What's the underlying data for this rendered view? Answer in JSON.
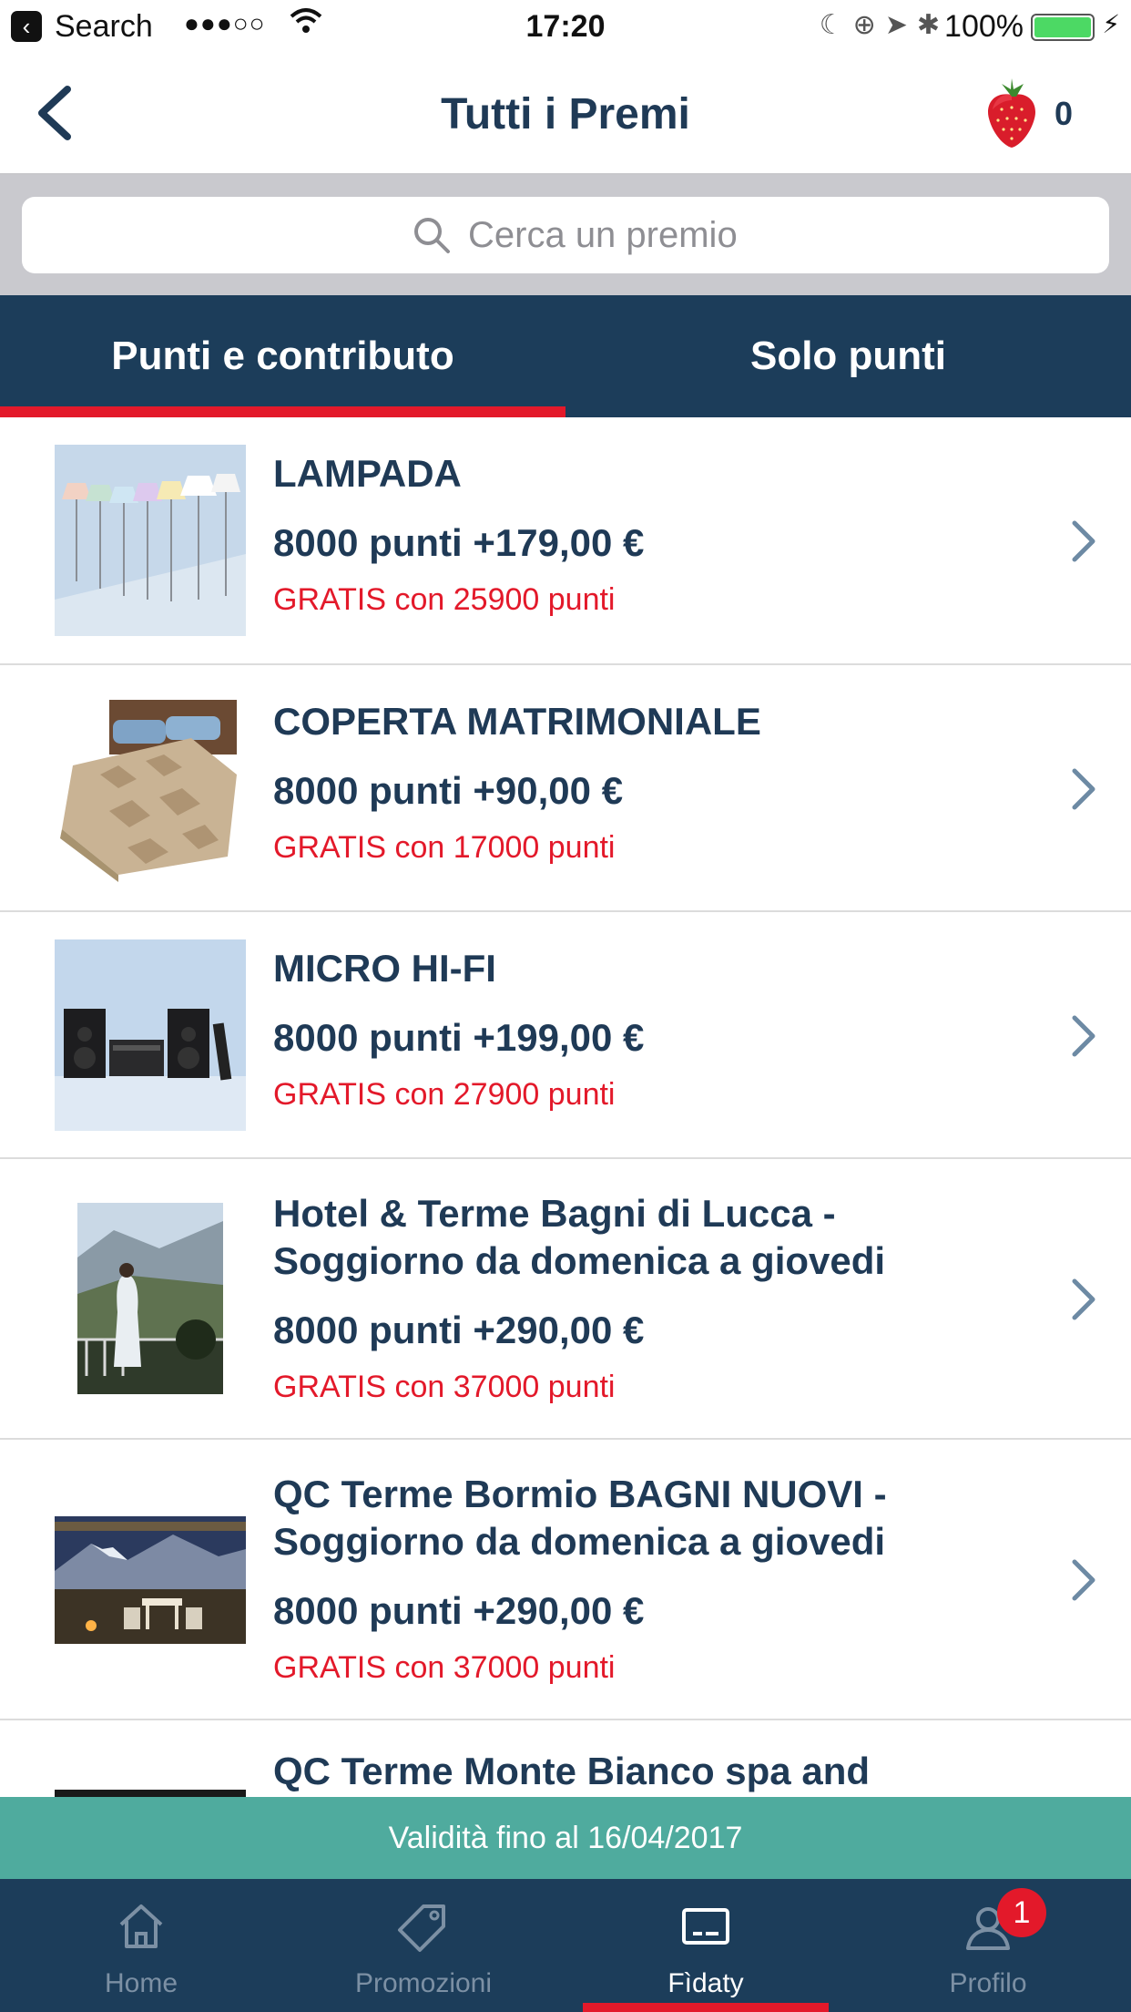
{
  "status_bar": {
    "carrier": "Search",
    "signal": "●●●○○",
    "time": "17:20",
    "battery": "100%"
  },
  "nav": {
    "title": "Tutti i Premi",
    "points": "0",
    "back_icon": "chevron-left-icon",
    "points_icon": "strawberry-icon"
  },
  "search": {
    "placeholder": "Cerca un premio",
    "value": ""
  },
  "tabs": [
    {
      "label": "Punti e contributo",
      "active": true
    },
    {
      "label": "Solo punti",
      "active": false
    }
  ],
  "items": [
    {
      "name": "LAMPADA",
      "price": "8000 punti +179,00 €",
      "free": "GRATIS con 25900 punti"
    },
    {
      "name": "COPERTA MATRIMONIALE",
      "price": "8000 punti +90,00 €",
      "free": "GRATIS con 17000 punti"
    },
    {
      "name": "MICRO HI-FI",
      "price": "8000 punti +199,00 €",
      "free": "GRATIS con 27900 punti"
    },
    {
      "name": "Hotel & Terme Bagni di Lucca - Soggiorno da domenica a giovedi",
      "price": "8000 punti +290,00 €",
      "free": "GRATIS con 37000 punti"
    },
    {
      "name": "QC Terme Bormio BAGNI NUOVI - Soggiorno da domenica a giovedi",
      "price": "8000 punti +290,00 €",
      "free": "GRATIS con 37000 punti"
    },
    {
      "name": "QC Terme Monte Bianco spa and",
      "price": "",
      "free": ""
    }
  ],
  "validity": "Validità fino al 16/04/2017",
  "tabbar": [
    {
      "label": "Home",
      "icon": "home-icon"
    },
    {
      "label": "Promozioni",
      "icon": "tag-icon"
    },
    {
      "label": "Fìdaty",
      "icon": "card-icon",
      "active": true
    },
    {
      "label": "Profilo",
      "icon": "user-icon",
      "badge": "1"
    }
  ],
  "colors": {
    "navy": "#1c3d5a",
    "text": "#1f3a56",
    "accent_red": "#e3192a",
    "teal": "#4fab9e"
  }
}
